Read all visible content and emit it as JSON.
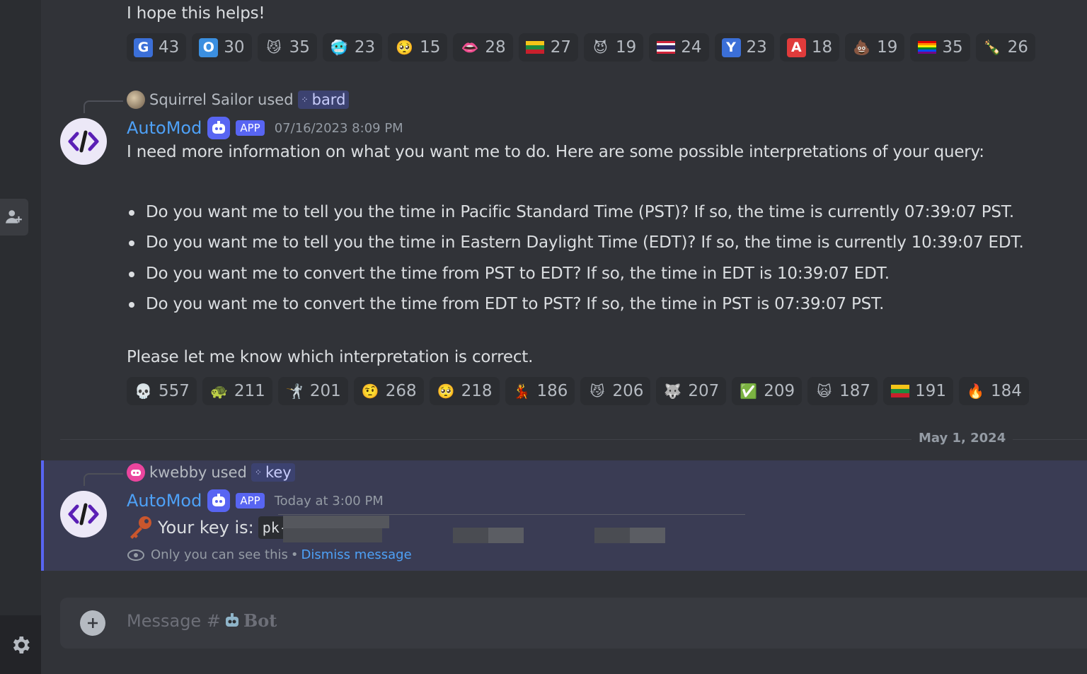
{
  "message_top": {
    "text": "I hope this helps!"
  },
  "reactions_top": [
    {
      "emoji": "G",
      "kind": "letter",
      "bg": "#3b6fd8",
      "count": "43"
    },
    {
      "emoji": "O",
      "kind": "letter",
      "bg": "#3b8fe0",
      "count": "30"
    },
    {
      "emoji": "😼",
      "kind": "emoji",
      "count": "35"
    },
    {
      "emoji": "🥶",
      "kind": "emoji",
      "count": "23"
    },
    {
      "emoji": "🥺",
      "kind": "emoji",
      "count": "15"
    },
    {
      "emoji": "👄",
      "kind": "emoji",
      "count": "28"
    },
    {
      "emoji": "🇱🇹",
      "kind": "flag-lt",
      "count": "27"
    },
    {
      "emoji": "😈",
      "kind": "emoji",
      "count": "19"
    },
    {
      "emoji": "🇹🇭",
      "kind": "flag-th",
      "count": "24"
    },
    {
      "emoji": "Y",
      "kind": "letter",
      "bg": "#3b6fd8",
      "count": "23"
    },
    {
      "emoji": "A",
      "kind": "letter",
      "bg": "#e03b3b",
      "count": "18"
    },
    {
      "emoji": "💩",
      "kind": "emoji",
      "count": "19"
    },
    {
      "emoji": "🏳️‍🌈",
      "kind": "flag-rainbow",
      "count": "35"
    },
    {
      "emoji": "🍾",
      "kind": "emoji",
      "count": "26"
    }
  ],
  "message1": {
    "reply_user": "Squirrel Sailor",
    "reply_used": "used",
    "reply_command": "bard",
    "author": "AutoMod",
    "badge": "APP",
    "timestamp": "07/16/2023 8:09 PM",
    "intro": "I need more information on what you want me to do. Here are some possible interpretations of your query:",
    "bullets": [
      "Do you want me to tell you the time in Pacific Standard Time (PST)? If so, the time is currently 07:39:07 PST.",
      "Do you want me to tell you the time in Eastern Daylight Time (EDT)? If so, the time is currently 10:39:07 EDT.",
      "Do you want me to convert the time from PST to EDT? If so, the time in EDT is 10:39:07 EDT.",
      "Do you want me to convert the time from EDT to PST? If so, the time in PST is 07:39:07 PST."
    ],
    "outro": "Please let me know which interpretation is correct."
  },
  "reactions_bottom": [
    {
      "emoji": "💀",
      "kind": "emoji",
      "count": "557"
    },
    {
      "emoji": "🐢",
      "kind": "emoji",
      "count": "211"
    },
    {
      "emoji": "🤺",
      "kind": "emoji",
      "count": "201"
    },
    {
      "emoji": "🤨",
      "kind": "emoji",
      "count": "268"
    },
    {
      "emoji": "🥺",
      "kind": "emoji",
      "count": "218"
    },
    {
      "emoji": "💃",
      "kind": "emoji",
      "count": "186"
    },
    {
      "emoji": "😼",
      "kind": "emoji",
      "count": "206"
    },
    {
      "emoji": "🐺",
      "kind": "emoji",
      "count": "207"
    },
    {
      "emoji": "✅",
      "kind": "emoji",
      "count": "209"
    },
    {
      "emoji": "🙀",
      "kind": "emoji",
      "count": "187"
    },
    {
      "emoji": "🇱🇹",
      "kind": "flag-lt",
      "count": "191"
    },
    {
      "emoji": "🔥",
      "kind": "emoji",
      "count": "184"
    }
  ],
  "date_divider": {
    "label": "May 1, 2024"
  },
  "message2": {
    "reply_user": "kwebby",
    "reply_used": "used",
    "reply_command": "key",
    "author": "AutoMod",
    "badge": "APP",
    "timestamp": "Today at 3:00 PM",
    "key_label": "Your key is:",
    "key_value": "pk-",
    "ephemeral_note": "Only you can see this",
    "separator": "•",
    "dismiss": "Dismiss message"
  },
  "composer": {
    "placeholder_prefix": "Message #",
    "channel": "Bot"
  },
  "colors": {
    "background": "#313338",
    "accent": "#5865f2",
    "link": "#4ea1f7",
    "highlight": "#3a3c54"
  },
  "icons": {
    "add_friend": "add-friend-icon",
    "settings": "gear-icon",
    "key": "key-icon",
    "eye": "eye-icon",
    "plus": "plus-icon"
  }
}
